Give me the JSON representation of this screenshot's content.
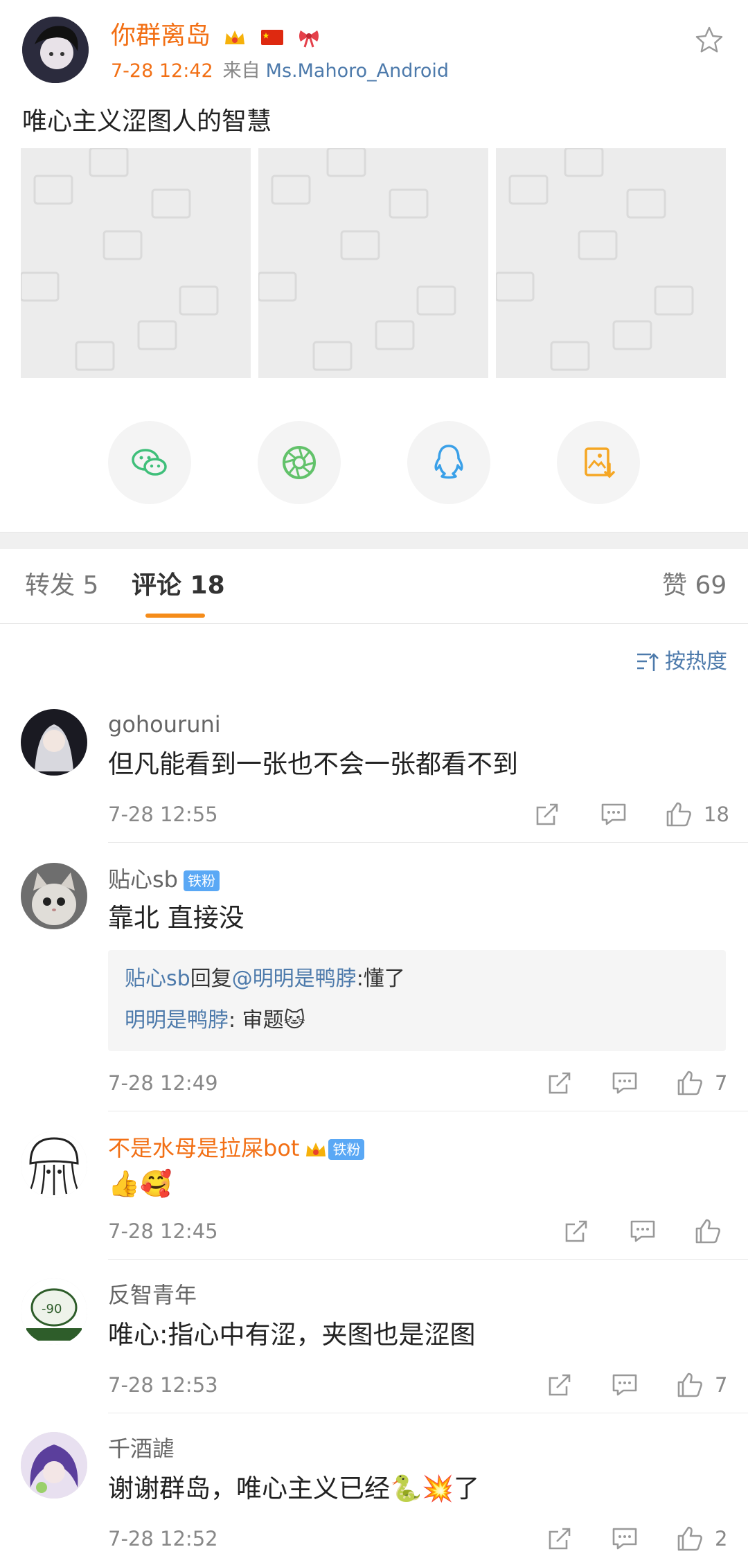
{
  "post": {
    "author": "你群离岛",
    "time": "7-28 12:42",
    "from_label": "来自",
    "source": "Ms.Mahoro_Android",
    "text": "唯心主义涩图人的智慧"
  },
  "tabs": {
    "repost": "转发 5",
    "comment": "评论 18",
    "like": "赞 69"
  },
  "sort_label": "按热度",
  "comments": [
    {
      "name": "gohouruni",
      "text": "但凡能看到一张也不会一张都看不到",
      "time": "7-28 12:55",
      "likes": "18"
    },
    {
      "name": "贴心sb",
      "tag": "铁粉",
      "text": "靠北 直接没",
      "time": "7-28 12:49",
      "likes": "7",
      "replies": [
        {
          "user": "贴心sb",
          "mid": "回复",
          "mention": "@明明是鸭脖",
          "text": ":懂了"
        },
        {
          "user": "明明是鸭脖",
          "text": ": 审题🐱"
        }
      ]
    },
    {
      "name": "不是水母是拉屎bot",
      "tag": "铁粉",
      "text": "👍🥰",
      "time": "7-28 12:45",
      "likes": ""
    },
    {
      "name": "反智青年",
      "text": "唯心:指心中有涩，夹图也是涩图",
      "time": "7-28 12:53",
      "likes": "7"
    },
    {
      "name": "千酒謔",
      "text": "谢谢群岛，唯心主义已经🐍💥了",
      "time": "7-28 12:52",
      "likes": "2"
    }
  ],
  "colors": {
    "accent": "#f26f14",
    "link": "#4d7aab",
    "wechat": "#3fbf7a",
    "moments": "#62c26a",
    "qq": "#3aa0e8",
    "save": "#f5a623"
  }
}
